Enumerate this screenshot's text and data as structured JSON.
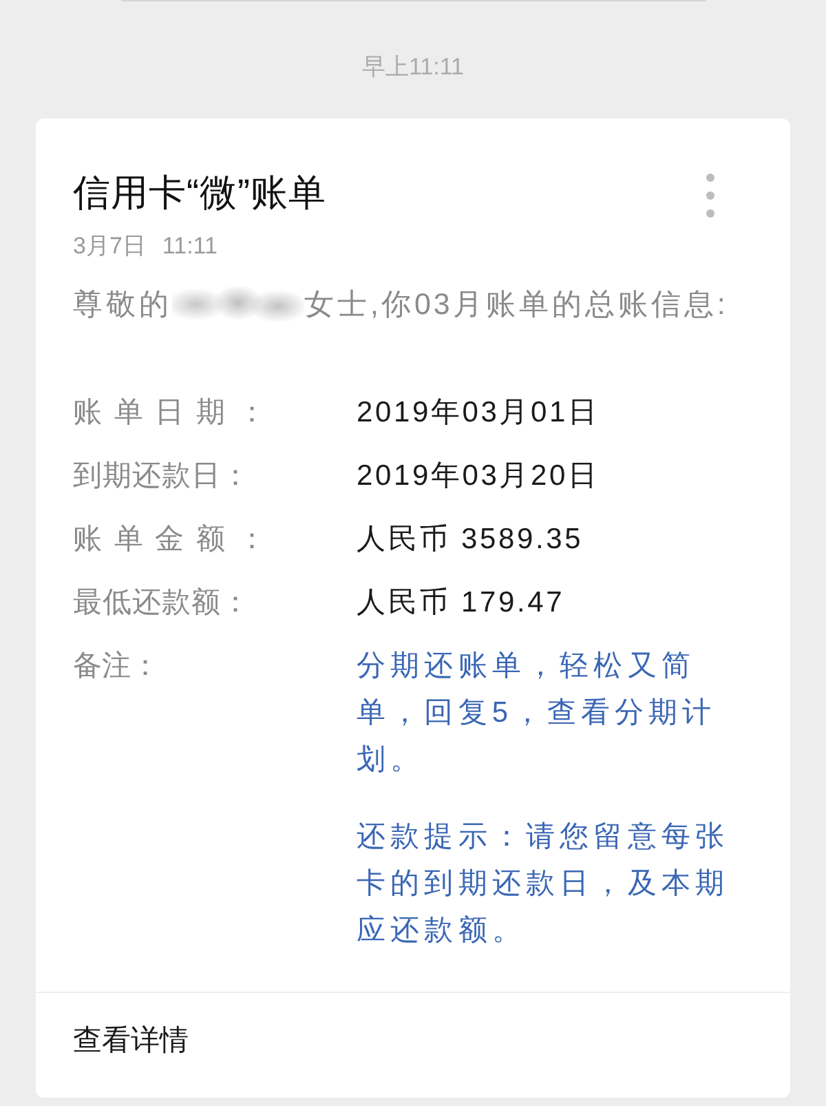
{
  "timestamp": "早上11:11",
  "card": {
    "title": "信用卡“微”账单",
    "date": "3月7日",
    "time": "11:11",
    "greeting": {
      "before": "尊敬的",
      "name_redacted": true,
      "after": "女士,你03月账单的总账信息:"
    },
    "fields": [
      {
        "label": "账 单 日 期 ：",
        "value": "2019年03月01日"
      },
      {
        "label": "到期还款日：",
        "value": "2019年03月20日"
      },
      {
        "label": "账 单 金 额 ：",
        "value": "人民币 3589.35"
      },
      {
        "label": "最低还款额：",
        "value": "人民币 179.47"
      }
    ],
    "remarks": {
      "label": "备注：",
      "paragraphs": [
        "分期还账单，轻松又简单，回复5，查看分期计划。",
        "还款提示：请您留意每张卡的到期还款日，及本期应还款额。"
      ]
    },
    "footer_link": "查看详情"
  }
}
